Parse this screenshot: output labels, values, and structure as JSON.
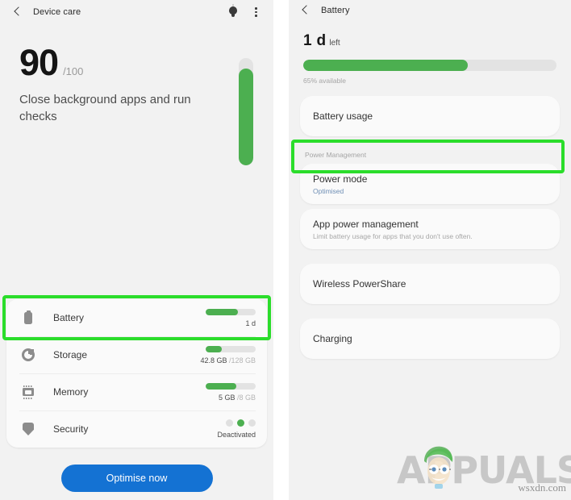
{
  "left_panel": {
    "appbar": {
      "back_icon": "back-chevron-icon",
      "title": "Device care",
      "bulb_icon": "lightbulb-icon",
      "menu_icon": "overflow-menu-icon"
    },
    "score": {
      "value": "90",
      "max": "/100",
      "description": "Close background apps and run checks",
      "gauge_percent": 90
    },
    "items": [
      {
        "icon": "battery-icon",
        "label": "Battery",
        "bar_percent": 65,
        "value": "1 d",
        "value_muted": "",
        "type": "bar",
        "highlighted": true
      },
      {
        "icon": "storage-icon",
        "label": "Storage",
        "bar_percent": 33,
        "value": "42.8 GB ",
        "value_muted": "/128 GB",
        "type": "bar",
        "highlighted": false
      },
      {
        "icon": "memory-icon",
        "label": "Memory",
        "bar_percent": 62,
        "value": "5 GB ",
        "value_muted": "/8 GB",
        "type": "bar",
        "highlighted": false
      },
      {
        "icon": "security-shield-icon",
        "label": "Security",
        "value": "Deactivated",
        "value_muted": "",
        "type": "dots",
        "dots_active_index": 1,
        "dots_count": 3,
        "highlighted": false
      }
    ],
    "optimise_button": "Optimise now"
  },
  "right_panel": {
    "appbar": {
      "back_icon": "back-chevron-icon",
      "title": "Battery"
    },
    "hero": {
      "big": "1 d",
      "small": "left",
      "bar_percent": 65,
      "caption": "65% available"
    },
    "battery_usage": {
      "title": "Battery usage"
    },
    "section_label": "Power Management",
    "power_mode": {
      "title": "Power mode",
      "subtitle": "Optimised",
      "highlighted": true
    },
    "app_power_management": {
      "title": "App power management",
      "subtitle": "Limit battery usage for apps that you don't use often."
    },
    "wireless_powershare": {
      "title": "Wireless PowerShare"
    },
    "charging": {
      "title": "Charging"
    }
  },
  "watermark": {
    "brand": "APPUALS",
    "source": "wsxdn.com"
  },
  "colors": {
    "green_accent": "#4caf50",
    "highlight_green": "#2bdd2b",
    "blue_button": "#1472d3",
    "panel_bg": "#f2f2f2",
    "card_bg": "#fafafa"
  }
}
